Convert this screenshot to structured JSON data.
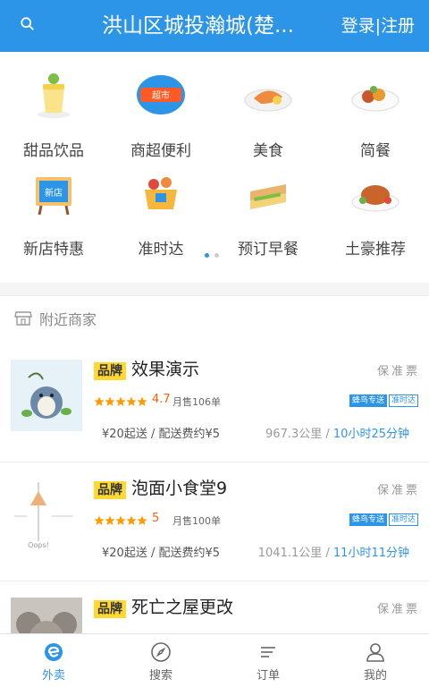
{
  "header": {
    "title": "洪山区城投瀚城(楚...",
    "login": "登录|注册",
    "search_icon": "search-icon"
  },
  "categories": [
    {
      "label": "甜品饮品",
      "icon": "dessert-drink-icon"
    },
    {
      "label": "商超便利",
      "icon": "supermarket-icon"
    },
    {
      "label": "美食",
      "icon": "food-icon"
    },
    {
      "label": "简餐",
      "icon": "simple-meal-icon"
    },
    {
      "label": "新店特惠",
      "icon": "new-store-icon"
    },
    {
      "label": "准时达",
      "icon": "on-time-icon"
    },
    {
      "label": "预订早餐",
      "icon": "breakfast-icon"
    },
    {
      "label": "土豪推荐",
      "icon": "premium-icon"
    }
  ],
  "pager": {
    "pages": 2,
    "current": 1
  },
  "nearby": {
    "title": "附近商家"
  },
  "shops": [
    {
      "brand": "品牌",
      "name": "效果演示",
      "tags": "保准票",
      "rating": "4.7",
      "rating_value": 4.7,
      "sales": "月售106单",
      "badge1": "蜂鸟专送",
      "badge2": "准时达",
      "fee": "¥20起送 / 配送费约¥5",
      "distance": "967.3公里 / ",
      "time": "10小时25分钟"
    },
    {
      "brand": "品牌",
      "name": "泡面小食堂9",
      "tags": "保准票",
      "rating": "5",
      "rating_value": 5,
      "sales": "月售100单",
      "badge1": "蜂鸟专送",
      "badge2": "准时达",
      "fee": "¥20起送 / 配送费约¥5",
      "distance": "1041.1公里 / ",
      "time": "11小时11分钟"
    },
    {
      "brand": "品牌",
      "name": "死亡之屋更改",
      "tags": "保准票"
    }
  ],
  "tabs": [
    {
      "label": "外卖",
      "icon": "takeout-icon",
      "active": true
    },
    {
      "label": "搜索",
      "icon": "compass-icon",
      "active": false
    },
    {
      "label": "订单",
      "icon": "order-list-icon",
      "active": false
    },
    {
      "label": "我的",
      "icon": "user-icon",
      "active": false
    }
  ],
  "colors": {
    "primary": "#2d95e8",
    "brand_tag": "#ffd931",
    "rating": "#ff6000"
  }
}
